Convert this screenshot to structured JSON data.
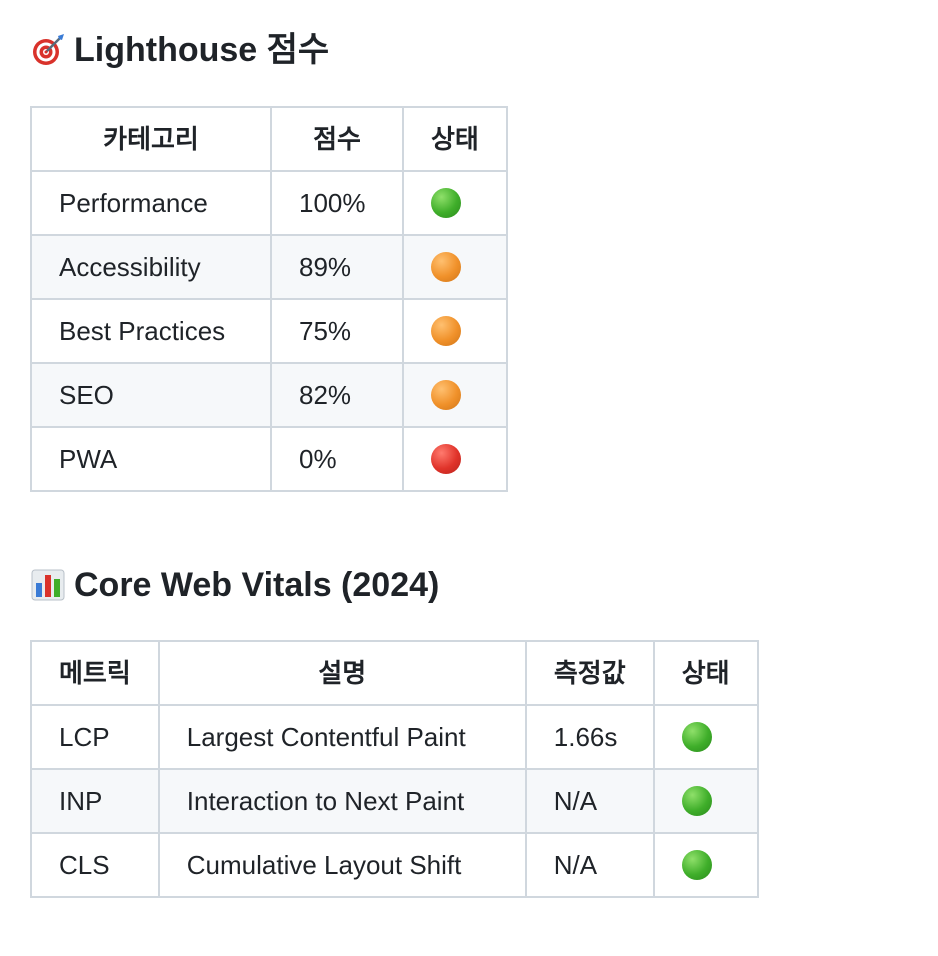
{
  "lighthouse": {
    "icon": "target-dart-icon",
    "title": "Lighthouse 점수",
    "headers": [
      "카테고리",
      "점수",
      "상태"
    ],
    "rows": [
      {
        "category": "Performance",
        "score": "100%",
        "status": "green"
      },
      {
        "category": "Accessibility",
        "score": "89%",
        "status": "orange"
      },
      {
        "category": "Best Practices",
        "score": "75%",
        "status": "orange"
      },
      {
        "category": "SEO",
        "score": "82%",
        "status": "orange"
      },
      {
        "category": "PWA",
        "score": "0%",
        "status": "red"
      }
    ]
  },
  "vitals": {
    "icon": "bar-chart-icon",
    "title": "Core Web Vitals (2024)",
    "headers": [
      "메트릭",
      "설명",
      "측정값",
      "상태"
    ],
    "rows": [
      {
        "metric": "LCP",
        "description": "Largest Contentful Paint",
        "value": "1.66s",
        "status": "green"
      },
      {
        "metric": "INP",
        "description": "Interaction to Next Paint",
        "value": "N/A",
        "status": "green"
      },
      {
        "metric": "CLS",
        "description": "Cumulative Layout Shift",
        "value": "N/A",
        "status": "green"
      }
    ]
  },
  "status_colors": {
    "green": "#3fae2a",
    "orange": "#f0912a",
    "red": "#e0332a"
  }
}
